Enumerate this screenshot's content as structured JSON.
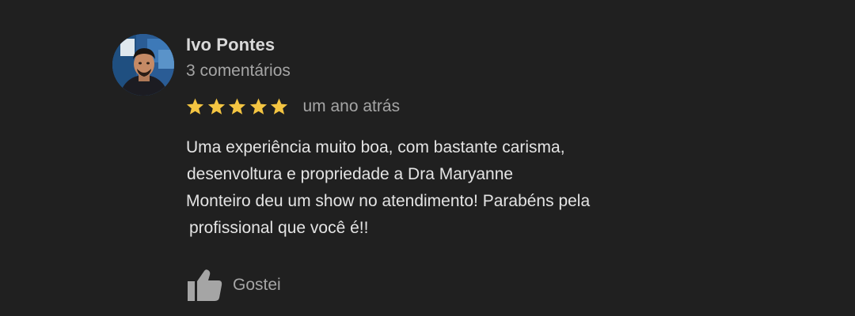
{
  "review": {
    "author_name": "Ivo Pontes",
    "author_meta": "3 comentários",
    "rating": 5,
    "rating_max": 5,
    "star_color": "#f4c542",
    "time": "um ano atrás",
    "text_lines": [
      "Uma experiência muito boa, com bastante carisma,",
      "desenvoltura e propriedade a Dra Maryanne",
      "Monteiro deu um show no atendimento! Parabéns pela",
      "profissional que você é!!"
    ],
    "like_label": "Gostei",
    "icons": {
      "avatar": "avatar",
      "star": "star-icon",
      "like": "thumbs-up-icon"
    }
  }
}
